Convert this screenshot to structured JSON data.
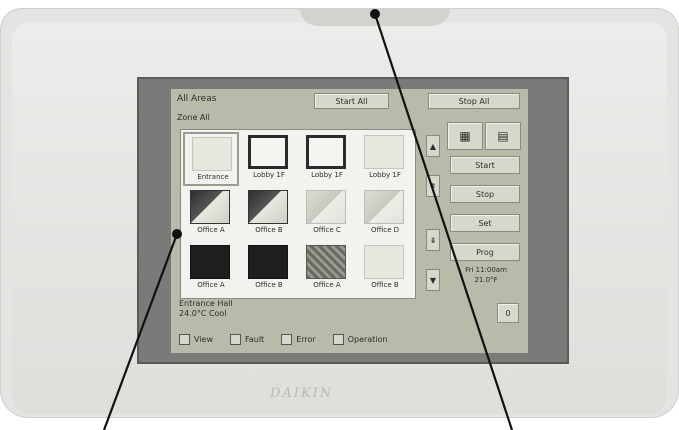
{
  "screen": {
    "title": "All Areas",
    "subtitle": "Zone All",
    "start_all_label": "Start All",
    "stop_all_label": "Stop All",
    "tiles": [
      {
        "label": "Entrance",
        "style": "light",
        "selected": true
      },
      {
        "label": "Lobby 1F",
        "style": "dark-frame"
      },
      {
        "label": "Lobby 1F",
        "style": "dark-frame"
      },
      {
        "label": "Lobby 1F",
        "style": "light"
      },
      {
        "label": "Office A",
        "style": "dark-box"
      },
      {
        "label": "Office B",
        "style": "dark-box"
      },
      {
        "label": "Office C",
        "style": "light-box"
      },
      {
        "label": "Office D",
        "style": "light-box"
      },
      {
        "label": "Office A",
        "style": "black"
      },
      {
        "label": "Office B",
        "style": "black"
      },
      {
        "label": "Office A",
        "style": "hatched"
      },
      {
        "label": "Office B",
        "style": "light"
      }
    ],
    "side_buttons": [
      {
        "label": "Start"
      },
      {
        "label": "Stop"
      },
      {
        "label": "Set"
      },
      {
        "label": "Prog"
      }
    ],
    "side_info": "Fri 11:00am\n21.0°F",
    "info_line1": "Entrance Hall",
    "info_line2": "24.0°C  Cool",
    "bottom_items": [
      {
        "label": "View"
      },
      {
        "label": "Fault"
      },
      {
        "label": "Error"
      },
      {
        "label": "Operation"
      }
    ],
    "small_button": "0"
  },
  "brand": "DAIKIN"
}
